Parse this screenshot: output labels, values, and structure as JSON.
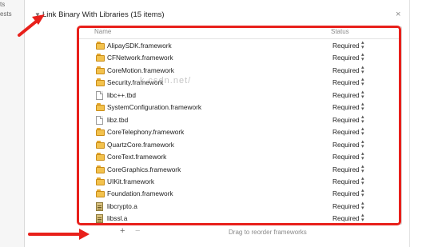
{
  "sidebar": {
    "items": [
      "ts",
      "ests"
    ]
  },
  "phase": {
    "title": "Link Binary With Libraries (15 items)",
    "close": "×"
  },
  "table": {
    "headers": {
      "name": "Name",
      "status": "Status"
    },
    "rows": [
      {
        "name": "AlipaySDK.framework",
        "status": "Required",
        "icon": "framework-icon"
      },
      {
        "name": "CFNetwork.framework",
        "status": "Required",
        "icon": "framework-icon"
      },
      {
        "name": "CoreMotion.framework",
        "status": "Required",
        "icon": "framework-icon"
      },
      {
        "name": "Security.framework",
        "status": "Required",
        "icon": "framework-icon"
      },
      {
        "name": "libc++.tbd",
        "status": "Required",
        "icon": "tbd-file-icon"
      },
      {
        "name": "SystemConfiguration.framework",
        "status": "Required",
        "icon": "framework-icon"
      },
      {
        "name": "libz.tbd",
        "status": "Required",
        "icon": "tbd-file-icon"
      },
      {
        "name": "CoreTelephony.framework",
        "status": "Required",
        "icon": "framework-icon"
      },
      {
        "name": "QuartzCore.framework",
        "status": "Required",
        "icon": "framework-icon"
      },
      {
        "name": "CoreText.framework",
        "status": "Required",
        "icon": "framework-icon"
      },
      {
        "name": "CoreGraphics.framework",
        "status": "Required",
        "icon": "framework-icon"
      },
      {
        "name": "UIKit.framework",
        "status": "Required",
        "icon": "framework-icon"
      },
      {
        "name": "Foundation.framework",
        "status": "Required",
        "icon": "framework-icon"
      },
      {
        "name": "libcrypto.a",
        "status": "Required",
        "icon": "static-library-icon"
      },
      {
        "name": "libssl.a",
        "status": "Required",
        "icon": "static-library-icon"
      }
    ]
  },
  "watermark": "k.csdn.net/",
  "bottom": {
    "add": "+",
    "remove": "−",
    "hint": "Drag to reorder frameworks"
  },
  "colors": {
    "annotation": "#e8201b",
    "folder": "#f3c24d"
  }
}
